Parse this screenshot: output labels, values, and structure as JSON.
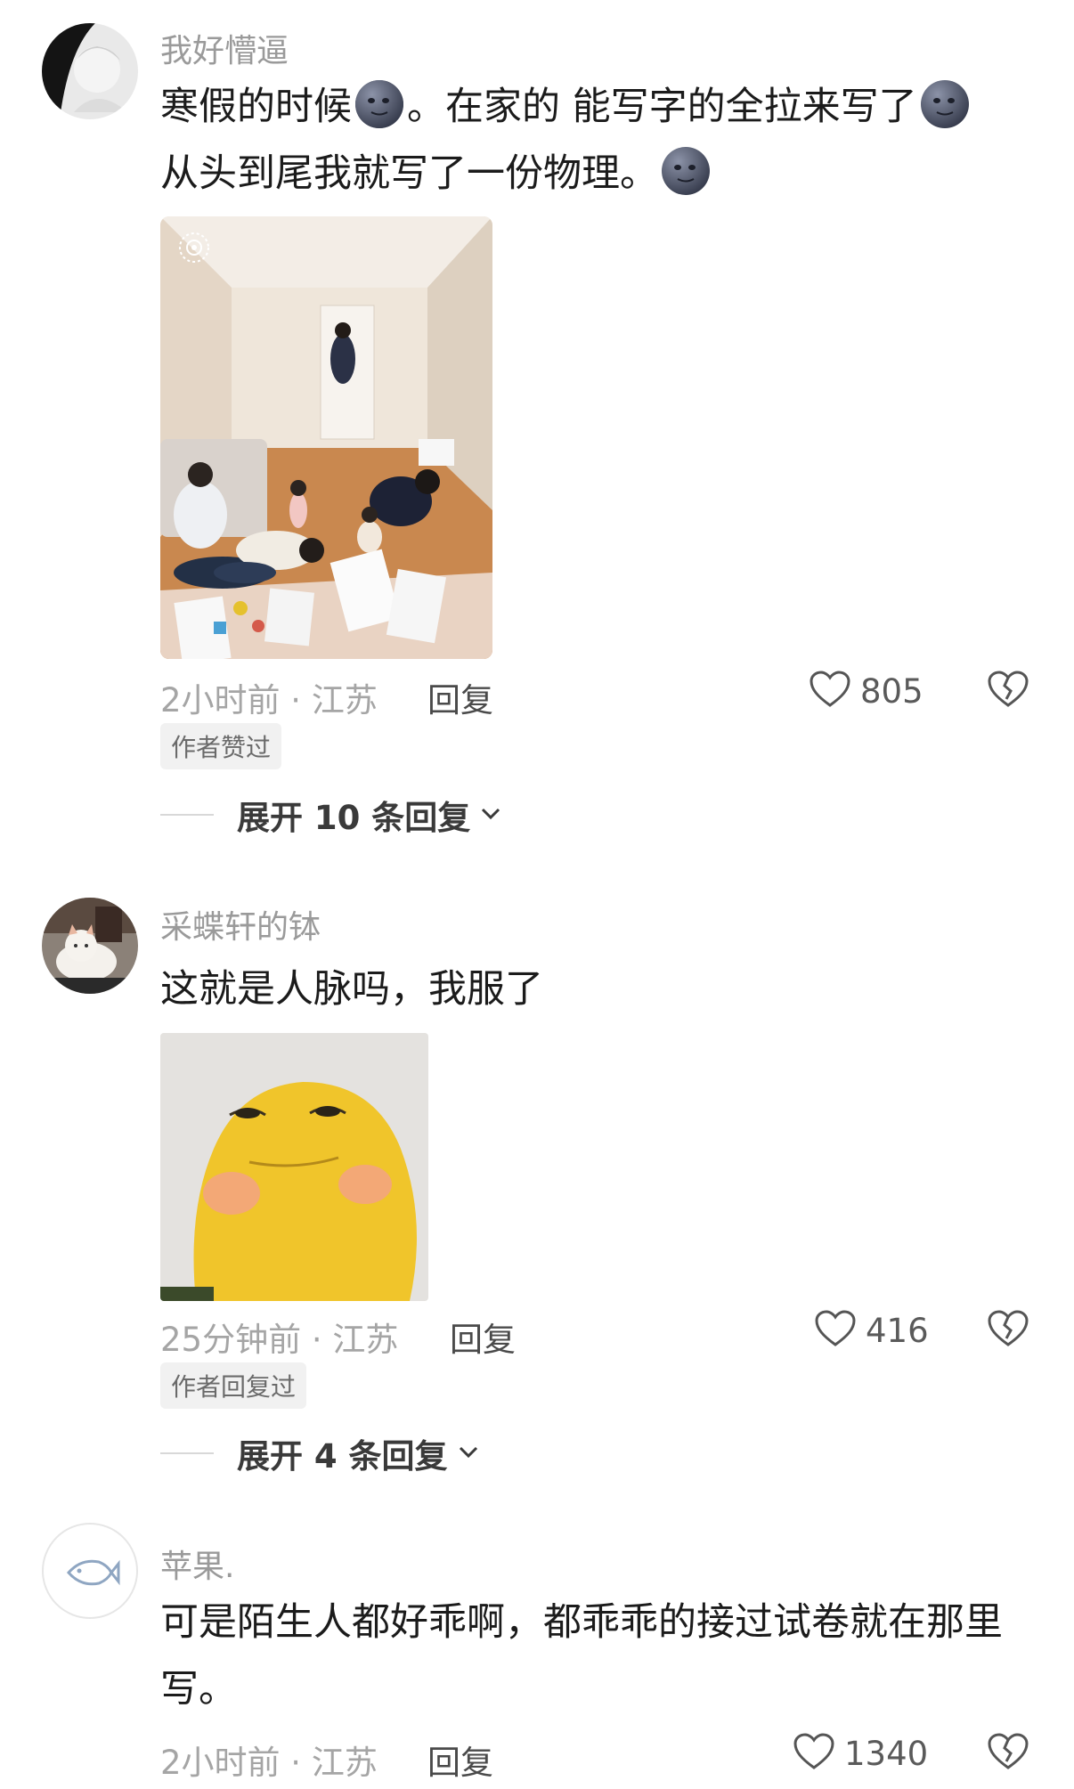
{
  "comments": [
    {
      "username": "我好懵逼",
      "text_line1_a": "寒假的时候",
      "text_line1_b": "。在家的 能写字的全拉来写了",
      "text_line2": "从头到尾我就写了一份物理。",
      "emoji_name": "moon-face-emoji",
      "media_name": "family-studying-photo",
      "time_location": "2小时前 · 江苏",
      "reply_label": "回复",
      "likes": "805",
      "tag": "作者赞过",
      "expand_label": "展开 10 条回复"
    },
    {
      "username": "采蝶轩的钵",
      "text": "这就是人脉吗，我服了",
      "media_name": "yellow-frog-sticker",
      "time_location": "25分钟前 · 江苏",
      "reply_label": "回复",
      "likes": "416",
      "tag": "作者回复过",
      "expand_label": "展开 4 条回复"
    },
    {
      "username": "苹果.",
      "text_line1": "可是陌生人都好乖啊，都乖乖的接过试卷就在那里",
      "text_line2": "写。",
      "time_location": "2小时前 · 江苏",
      "reply_label": "回复",
      "likes": "1340"
    }
  ],
  "icons": {
    "like": "heart-outline-icon",
    "dislike": "broken-heart-icon",
    "expand": "chevron-down-icon",
    "default_avatar": "fish-icon"
  },
  "colors": {
    "username": "#9a9a9a",
    "meta": "#a5a5a5",
    "tag_bg": "#f1f1f1"
  }
}
